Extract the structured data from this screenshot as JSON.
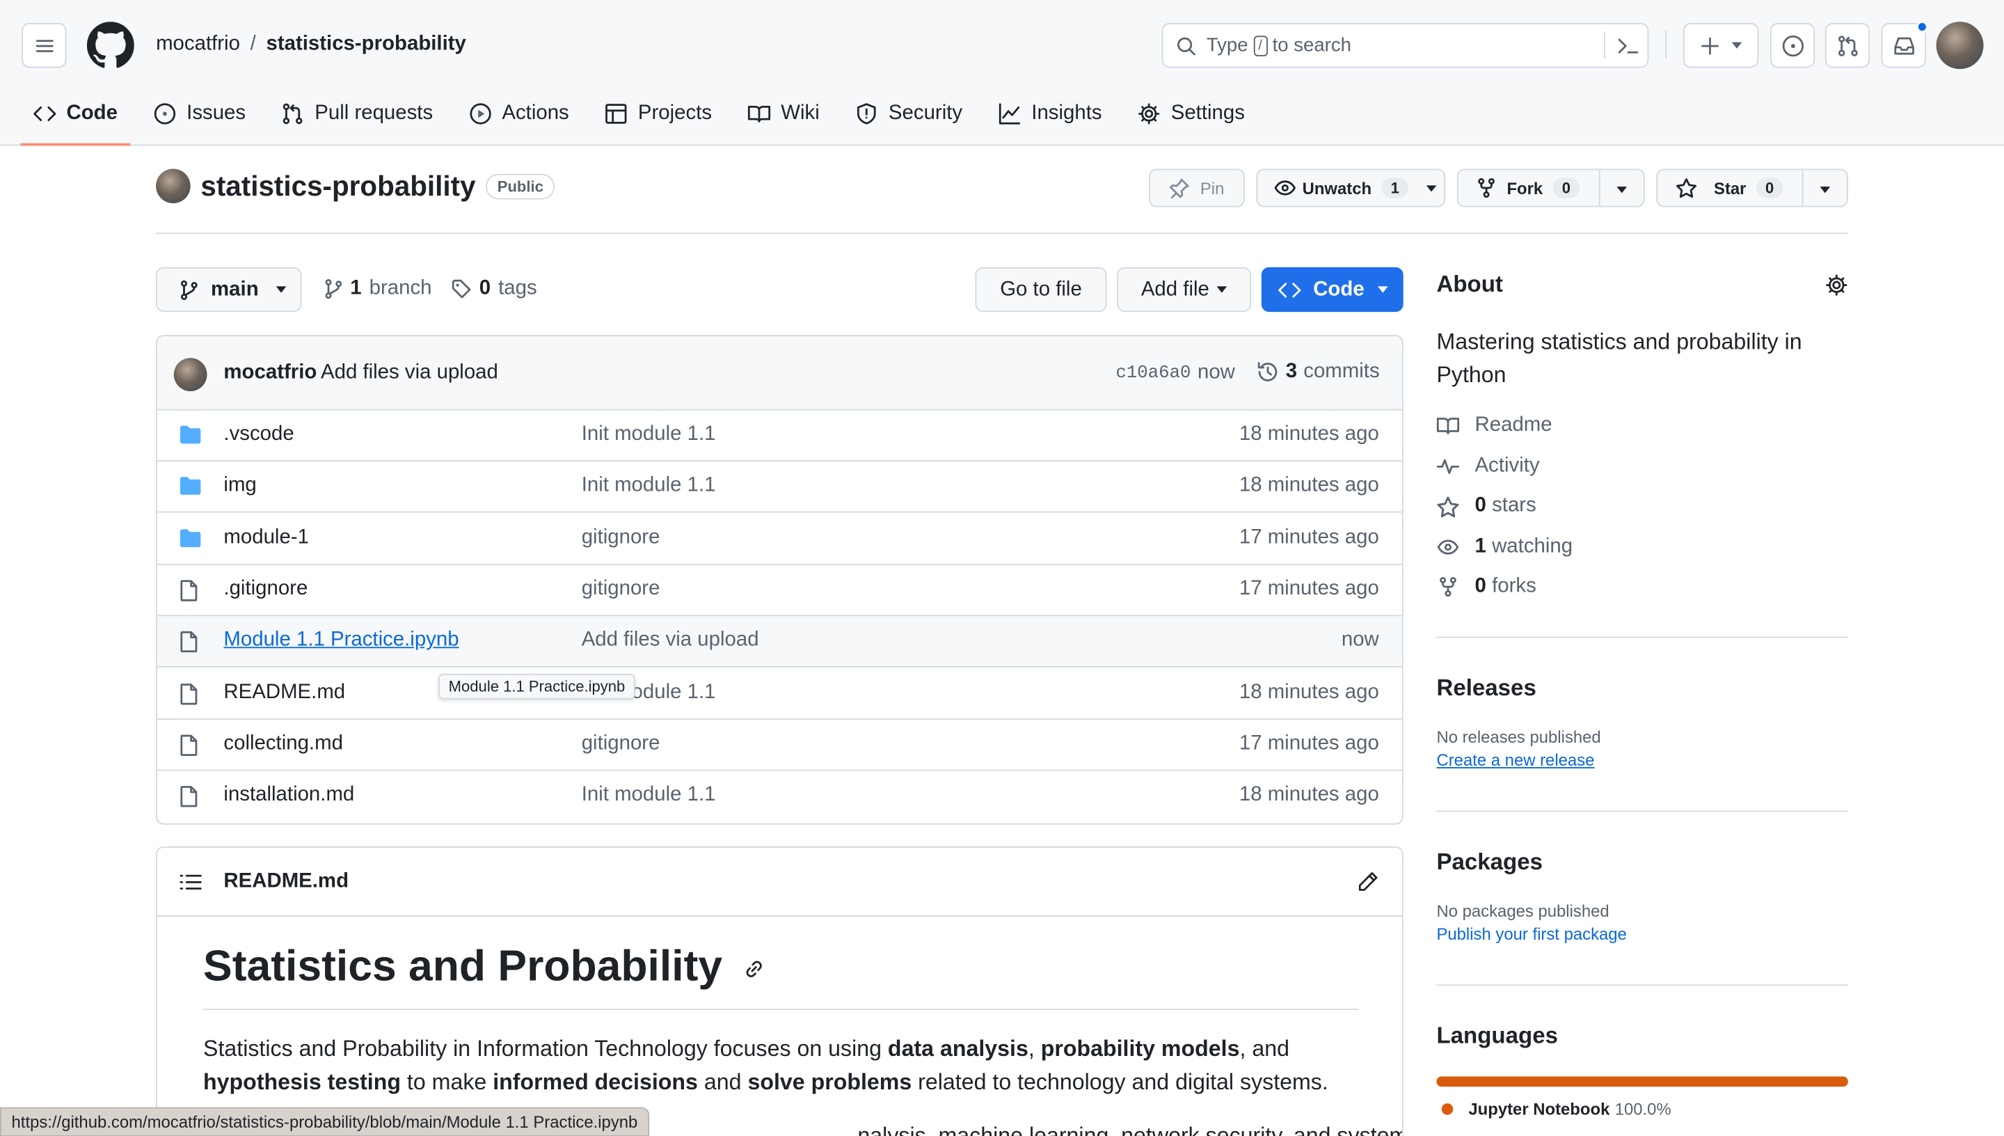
{
  "header": {
    "owner": "mocatfrio",
    "separator": "/",
    "repo": "statistics-probability",
    "search_prefix": "Type",
    "search_key": "/",
    "search_suffix": "to search"
  },
  "tabs": [
    {
      "label": "Code",
      "icon": "code-icon"
    },
    {
      "label": "Issues",
      "icon": "issue-icon"
    },
    {
      "label": "Pull requests",
      "icon": "pull-request-icon"
    },
    {
      "label": "Actions",
      "icon": "play-icon"
    },
    {
      "label": "Projects",
      "icon": "table-icon"
    },
    {
      "label": "Wiki",
      "icon": "book-icon"
    },
    {
      "label": "Security",
      "icon": "shield-icon"
    },
    {
      "label": "Insights",
      "icon": "graph-icon"
    },
    {
      "label": "Settings",
      "icon": "gear-icon"
    }
  ],
  "repo_head": {
    "name": "statistics-probability",
    "visibility": "Public",
    "pin": "Pin",
    "unwatch": "Unwatch",
    "watch_count": "1",
    "fork": "Fork",
    "fork_count": "0",
    "star": "Star",
    "star_count": "0"
  },
  "filenav": {
    "branch": "main",
    "branches_count": "1",
    "branches_label": "branch",
    "tags_count": "0",
    "tags_label": "tags",
    "go_to_file": "Go to file",
    "add_file": "Add file",
    "code": "Code"
  },
  "commit": {
    "author": "mocatfrio",
    "message": "Add files via upload",
    "sha": "c10a6a0",
    "time": "now",
    "commits_count": "3",
    "commits_label": "commits"
  },
  "files": [
    {
      "type": "folder",
      "name": ".vscode",
      "message": "Init module 1.1",
      "age": "18 minutes ago"
    },
    {
      "type": "folder",
      "name": "img",
      "message": "Init module 1.1",
      "age": "18 minutes ago"
    },
    {
      "type": "folder",
      "name": "module-1",
      "message": "gitignore",
      "age": "17 minutes ago"
    },
    {
      "type": "file",
      "name": ".gitignore",
      "message": "gitignore",
      "age": "17 minutes ago"
    },
    {
      "type": "file",
      "name": "Module 1.1 Practice.ipynb",
      "message": "Add files via upload",
      "age": "now"
    },
    {
      "type": "file",
      "name": "README.md",
      "message": "Init module 1.1",
      "age": "18 minutes ago"
    },
    {
      "type": "file",
      "name": "collecting.md",
      "message": "gitignore",
      "age": "17 minutes ago"
    },
    {
      "type": "file",
      "name": "installation.md",
      "message": "Init module 1.1",
      "age": "18 minutes ago"
    }
  ],
  "tooltip": "Module 1.1 Practice.ipynb",
  "readme": {
    "filename": "README.md",
    "title": "Statistics and Probability",
    "p1_a": "Statistics and Probability in Information Technology focuses on using ",
    "p1_b": "data analysis",
    "p1_c": ", ",
    "p1_d": "probability models",
    "p1_e": ", and ",
    "p1_f": "hypothesis testing",
    "p1_g": " to make ",
    "p1_h": "informed decisions",
    "p1_i": " and ",
    "p1_j": "solve problems",
    "p1_k": " related to technology and digital systems.",
    "p2": "nalysis, machine learning, network security, and system"
  },
  "about": {
    "heading": "About",
    "description": "Mastering statistics and probability in Python",
    "readme": "Readme",
    "activity": "Activity",
    "stars_count": "0",
    "stars_label": "stars",
    "watching_count": "1",
    "watching_label": "watching",
    "forks_count": "0",
    "forks_label": "forks"
  },
  "releases": {
    "heading": "Releases",
    "empty": "No releases published",
    "link": "Create a new release"
  },
  "packages": {
    "heading": "Packages",
    "empty": "No packages published",
    "link": "Publish your first package"
  },
  "languages": {
    "heading": "Languages",
    "items": [
      {
        "name": "Jupyter Notebook",
        "percent": "100.0%",
        "color": "#DA5B0B"
      }
    ]
  },
  "status_url": "https://github.com/mocatfrio/statistics-probability/blob/main/Module 1.1 Practice.ipynb",
  "colors": {
    "accent": "#1f6feb",
    "link": "#0969da",
    "tab_underline": "#fd8c73",
    "notification": "#0969da"
  }
}
